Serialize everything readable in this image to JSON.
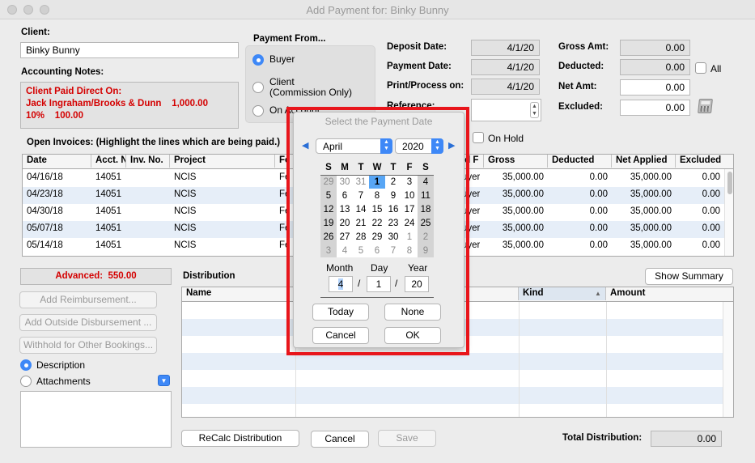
{
  "window": {
    "title": "Add Payment for: Binky Bunny"
  },
  "client": {
    "label": "Client:",
    "value": "Binky Bunny"
  },
  "accounting_notes": {
    "label": "Accounting Notes:",
    "lines": [
      "Client Paid Direct On:",
      "Jack Ingraham/Brooks & Dunn    1,000.00",
      "10%    100.00"
    ]
  },
  "payment_from": {
    "label": "Payment From...",
    "options": [
      "Buyer",
      "Client",
      "(Commission Only)",
      "On Account"
    ],
    "selected": "Buyer"
  },
  "dates": {
    "deposit_label": "Deposit Date:",
    "deposit": "4/1/20",
    "payment_label": "Payment Date:",
    "payment": "4/1/20",
    "print_label": "Print/Process on:",
    "print": "4/1/20",
    "reference_label": "Reference:"
  },
  "amounts": {
    "gross_label": "Gross Amt:",
    "gross": "0.00",
    "deducted_label": "Deducted:",
    "deducted": "0.00",
    "all_label": "All",
    "net_label": "Net Amt:",
    "net": "0.00",
    "excluded_label": "Excluded:",
    "excluded": "0.00"
  },
  "on_hold_label": "On Hold",
  "invoices": {
    "label": "Open Invoices: (Highlight the lines which are being paid.)",
    "columns": [
      "Date",
      "Acct. N",
      "Inv. No.",
      "Project",
      "Fe",
      "id F",
      "Gross",
      "Deducted",
      "Net Applied",
      "Excluded"
    ],
    "rows": [
      [
        "04/16/18",
        "14051",
        "",
        "NCIS",
        "Fe",
        "uyer",
        "35,000.00",
        "0.00",
        "35,000.00",
        "0.00"
      ],
      [
        "04/23/18",
        "14051",
        "",
        "NCIS",
        "Fe",
        "uyer",
        "35,000.00",
        "0.00",
        "35,000.00",
        "0.00"
      ],
      [
        "04/30/18",
        "14051",
        "",
        "NCIS",
        "Fe",
        "uyer",
        "35,000.00",
        "0.00",
        "35,000.00",
        "0.00"
      ],
      [
        "05/07/18",
        "14051",
        "",
        "NCIS",
        "Fe",
        "uyer",
        "35,000.00",
        "0.00",
        "35,000.00",
        "0.00"
      ],
      [
        "05/14/18",
        "14051",
        "",
        "NCIS",
        "Fe",
        "uyer",
        "35,000.00",
        "0.00",
        "35,000.00",
        "0.00"
      ]
    ]
  },
  "advanced": {
    "text": "Advanced:  550.00"
  },
  "side_buttons": {
    "reimb": "Add Reimbursement...",
    "outside": "Add Outside Disbursement ...",
    "withhold": "Withhold for Other Bookings..."
  },
  "desc_radio": {
    "description": "Description",
    "attachments": "Attachments"
  },
  "distribution": {
    "label": "Distribution",
    "show_summary": "Show Summary",
    "columns": [
      "Name",
      "Kind",
      "Amount"
    ]
  },
  "footer": {
    "recalc": "ReCalc Distribution",
    "cancel": "Cancel",
    "save": "Save",
    "total_label": "Total Distribution:",
    "total": "0.00"
  },
  "picker": {
    "title": "Select the Payment Date",
    "month_name": "April",
    "year_name": "2020",
    "weekdays": [
      "S",
      "M",
      "T",
      "W",
      "T",
      "F",
      "S"
    ],
    "weeks": [
      [
        "29",
        "30",
        "31",
        "1",
        "2",
        "3",
        "4"
      ],
      [
        "5",
        "6",
        "7",
        "8",
        "9",
        "10",
        "11"
      ],
      [
        "12",
        "13",
        "14",
        "15",
        "16",
        "17",
        "18"
      ],
      [
        "19",
        "20",
        "21",
        "22",
        "23",
        "24",
        "25"
      ],
      [
        "26",
        "27",
        "28",
        "29",
        "30",
        "1",
        "2"
      ],
      [
        "3",
        "4",
        "5",
        "6",
        "7",
        "8",
        "9"
      ]
    ],
    "month_label": "Month",
    "day_label": "Day",
    "year_label": "Year",
    "month": "4",
    "day": "1",
    "year": "20",
    "sep": "/",
    "today": "Today",
    "none": "None",
    "cancel": "Cancel",
    "ok": "OK"
  },
  "colors": {
    "highlight": "#e8151b",
    "accent": "#3e88f7",
    "note_red": "#d40000"
  }
}
